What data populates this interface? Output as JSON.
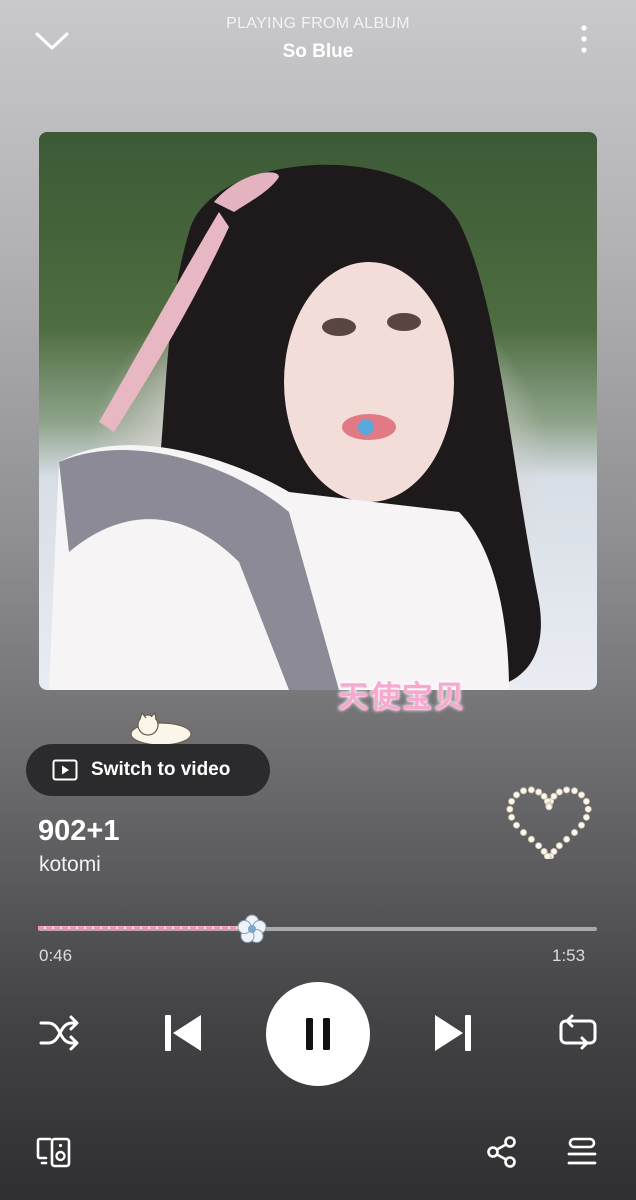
{
  "header": {
    "context_label": "PLAYING FROM ALBUM",
    "album_title": "So Blue"
  },
  "artwork": {
    "overlay_text": "天使宝贝"
  },
  "switch_video": {
    "label": "Switch to video"
  },
  "track": {
    "title": "902+1",
    "artist": "kotomi",
    "liked": false
  },
  "progress": {
    "current": "0:46",
    "total": "1:53",
    "fraction": 0.407
  },
  "controls": {
    "shuffle": "shuffle-icon",
    "previous": "skip-previous-icon",
    "play_pause": "pause-icon",
    "next": "skip-next-icon",
    "repeat": "repeat-icon"
  },
  "footer": {
    "devices": "connect-device-icon",
    "share": "share-icon",
    "queue": "queue-icon"
  },
  "colors": {
    "accent_pink": "#f58fb8",
    "button_bg": "#2b2b2d",
    "play_button": "#ffffff"
  }
}
